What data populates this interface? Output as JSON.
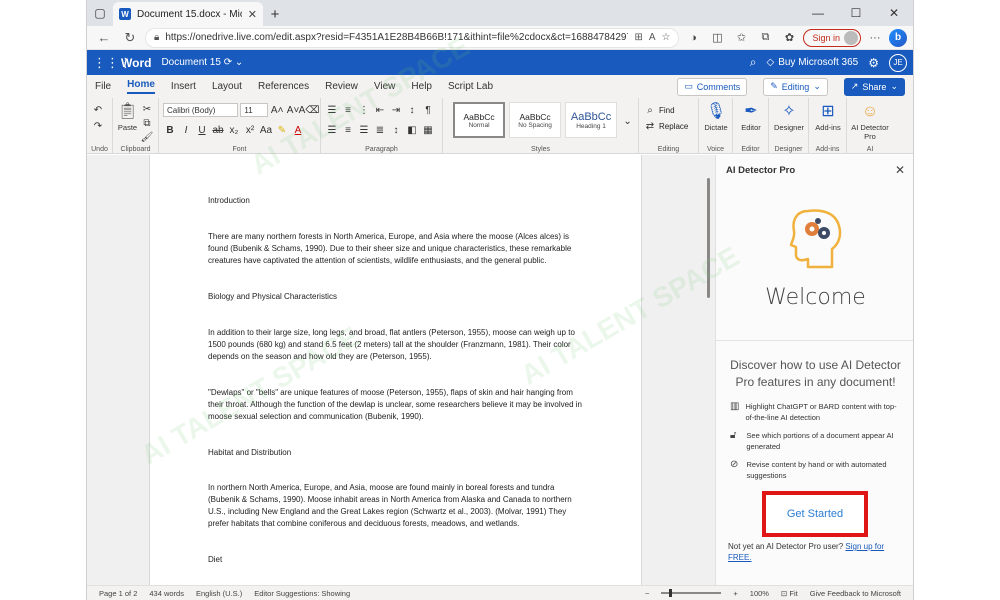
{
  "browser": {
    "tab_title": "Document 15.docx - Microsoft W",
    "tab_app_icon": "W",
    "url": "https://onedrive.live.com/edit.aspx?resid=F4351A1E28B4B66B!171&ithint=file%2cdocx&ct=1688478429719...",
    "signin_label": "Sign in"
  },
  "word": {
    "app_name": "Word",
    "doc_name": "Document 15",
    "buy_label": "Buy Microsoft 365",
    "user_initials": "JE"
  },
  "ribbon_tabs": [
    "File",
    "Home",
    "Insert",
    "Layout",
    "References",
    "Review",
    "View",
    "Help",
    "Script Lab"
  ],
  "ribbon_right": {
    "comments": "Comments",
    "editing": "Editing",
    "share": "Share"
  },
  "ribbon": {
    "undo_label": "Undo",
    "clipboard_label": "Clipboard",
    "paste_label": "Paste",
    "font_name": "Calibri (Body)",
    "font_size": "11",
    "font_label": "Font",
    "paragraph_label": "Paragraph",
    "styles": [
      "Normal",
      "No Spacing",
      "Heading 1"
    ],
    "style_sample": "AaBbCc",
    "styles_label": "Styles",
    "find_label": "Find",
    "replace_label": "Replace",
    "editing_group_label": "Editing",
    "dictate_label": "Dictate",
    "voice_label": "Voice",
    "editor_label": "Editor",
    "editor_group_label": "Editor",
    "designer_label": "Designer",
    "designer_group_label": "Designer",
    "addins_label": "Add-ins",
    "addins_group_label": "Add-ins",
    "ai_detector_label": "AI Detector Pro",
    "ai_group_label": "AI"
  },
  "document": {
    "paragraphs": [
      "Introduction",
      "There are many northern forests in North America, Europe, and Asia where the moose (Alces alces) is found (Bubenik & Schams, 1990). Due to their sheer size and unique characteristics, these remarkable creatures have captivated the attention of scientists, wildlife enthusiasts, and the general public.",
      "Biology and Physical Characteristics",
      "In addition to their large size, long legs, and broad, flat antlers (Peterson, 1955), moose can weigh up to 1500 pounds (680 kg) and stand 6.5 feet (2 meters) tall at the shoulder (Franzmann, 1981). Their color depends on the season and how old they are (Peterson, 1955).",
      "\"Dewlaps\" or \"bells\" are unique features of moose (Peterson, 1955), flaps of skin and hair hanging from their throat. Although the function of the dewlap is unclear, some researchers believe it may be involved in moose sexual selection and communication (Bubenik, 1990).",
      "Habitat and Distribution",
      "In northern North America, Europe, and Asia, moose are found mainly in boreal forests and tundra (Bubenik & Schams, 1990). Moose inhabit areas in North America from Alaska and Canada to northern U.S., including New England and the Great Lakes region (Schwartz et al., 2003). (Molvar, 1991) They prefer habitats that combine coniferous and deciduous forests, meadows, and wetlands.",
      "Diet"
    ]
  },
  "pane": {
    "title": "AI Detector Pro",
    "welcome": "Welcome",
    "discover": "Discover how to use AI Detector Pro features in any document!",
    "features": [
      {
        "icon": "highlighter-icon",
        "text": "Highlight ChatGPT or BARD content with top-of-the-line AI detection"
      },
      {
        "icon": "lock-icon",
        "text": "See which portions of a document appear AI generated"
      },
      {
        "icon": "revise-icon",
        "text": "Revise content by hand or with automated suggestions"
      }
    ],
    "get_started": "Get Started",
    "not_yet": "Not yet an AI Detector Pro user?",
    "signup": "Sign up for FREE."
  },
  "status_bar": {
    "page": "Page 1 of 2",
    "words": "434 words",
    "language": "English (U.S.)",
    "editor": "Editor Suggestions: Showing",
    "zoom": "100%",
    "fit": "Fit",
    "feedback": "Give Feedback to Microsoft"
  },
  "watermark": "AI TALENT SPACE",
  "colors": {
    "word_blue": "#185abd",
    "highlight_red": "#e01515",
    "link_blue": "#2b7cd3"
  }
}
